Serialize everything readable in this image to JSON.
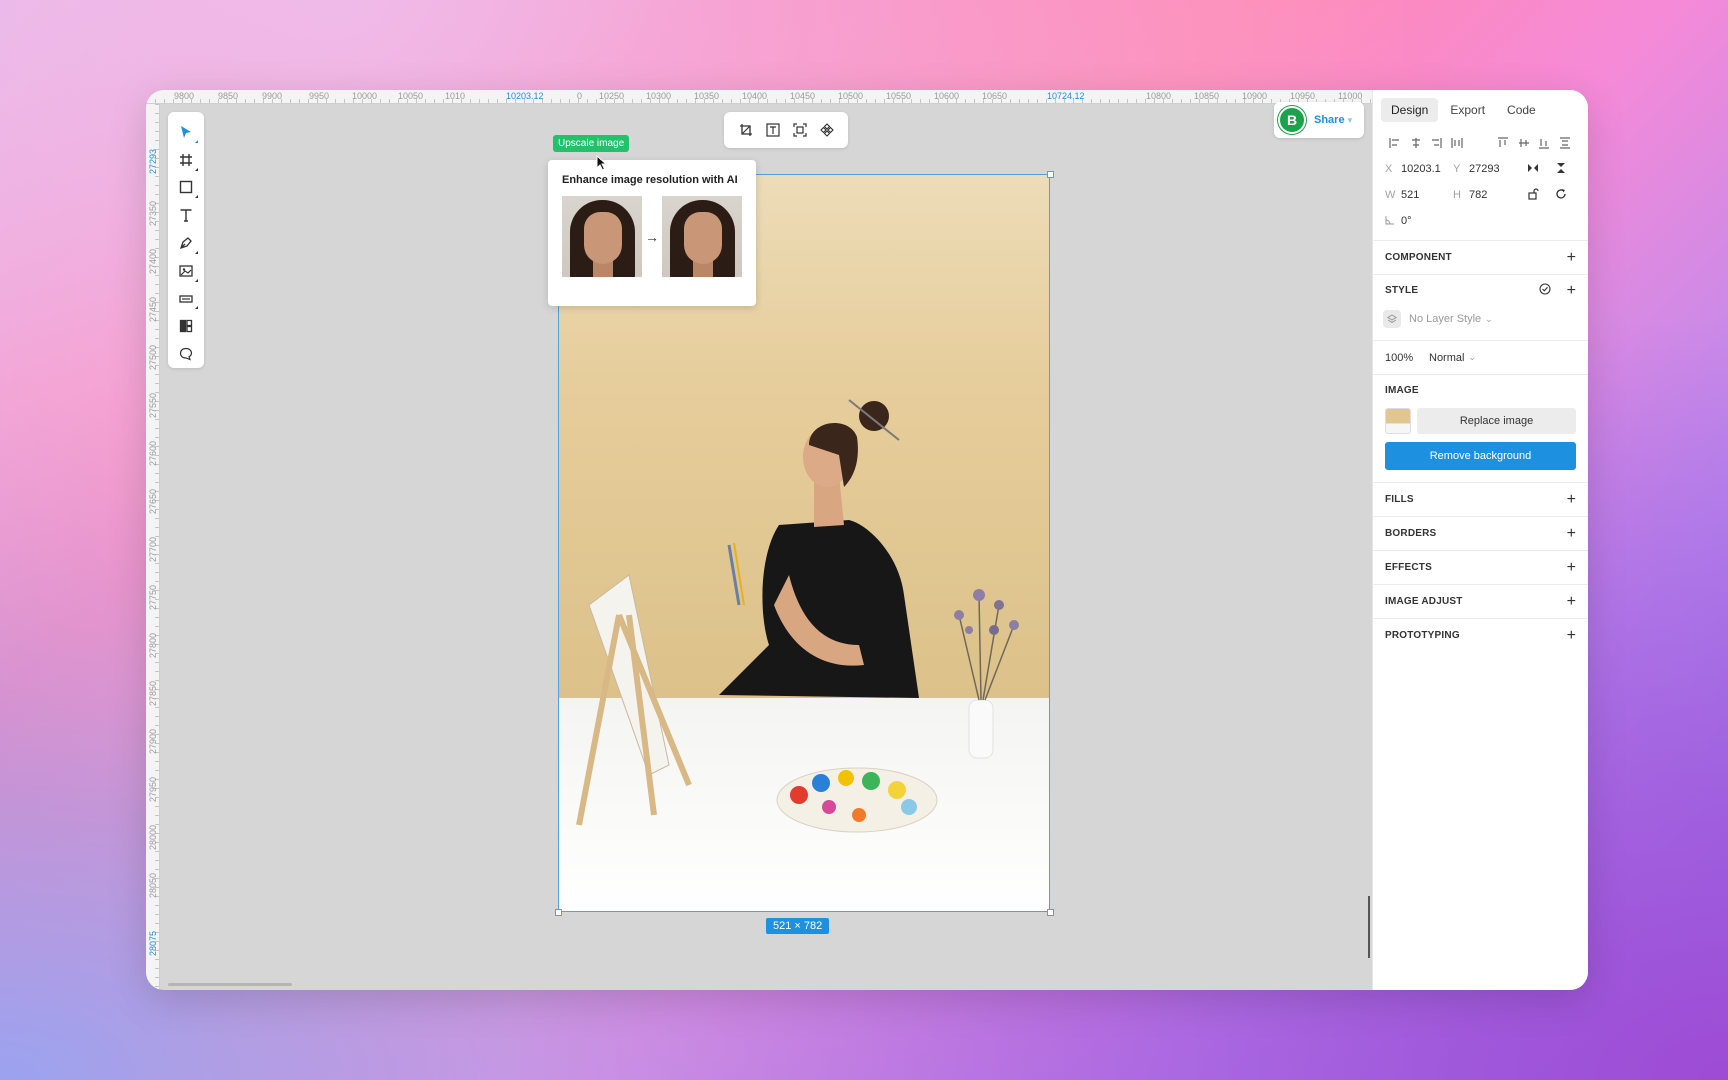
{
  "ruler_top": {
    "labels": [
      "9800",
      "9850",
      "9900",
      "9950",
      "10000",
      "10050",
      "1010",
      "10203.12",
      "0",
      "10250",
      "10300",
      "10350",
      "10400",
      "10450",
      "10500",
      "10550",
      "10600",
      "10650",
      "10724.12",
      "10800",
      "10850",
      "10900",
      "10950",
      "11000",
      "110"
    ],
    "highlighted": [
      "10203.12",
      "10724.12"
    ]
  },
  "ruler_left": {
    "labels": [
      "27293",
      "27350",
      "27400",
      "27450",
      "27500",
      "27550",
      "27600",
      "27650",
      "27700",
      "27750",
      "27800",
      "27850",
      "27900",
      "27950",
      "28000",
      "28050",
      "28075"
    ],
    "highlighted": [
      "27293",
      "28075"
    ]
  },
  "toolbar": {
    "tools": [
      "move-tool",
      "frame-tool",
      "rectangle-tool",
      "text-tool",
      "pen-tool",
      "image-tool",
      "component-tool",
      "layout-tool",
      "comment-tool"
    ]
  },
  "actionbar": {
    "actions": [
      "crop-icon",
      "text-frame-icon",
      "upscale-icon",
      "component-icon"
    ]
  },
  "share": {
    "avatar_letter": "B",
    "label": "Share"
  },
  "canvas": {
    "upscale_tag": "Upscale image",
    "popover_title": "Enhance image resolution with AI",
    "size_badge": "521 × 782"
  },
  "panel": {
    "tabs": [
      "Design",
      "Export",
      "Code"
    ],
    "active_tab": "Design",
    "x_label": "X",
    "x_value": "10203.1",
    "y_label": "Y",
    "y_value": "27293",
    "w_label": "W",
    "w_value": "521",
    "h_label": "H",
    "h_value": "782",
    "rotation": "0°",
    "component_title": "COMPONENT",
    "style_title": "STYLE",
    "style_value": "No Layer Style",
    "opacity": "100%",
    "blend": "Normal",
    "image_title": "IMAGE",
    "replace_label": "Replace image",
    "remove_bg_label": "Remove background",
    "fills_title": "FILLS",
    "borders_title": "BORDERS",
    "effects_title": "EFFECTS",
    "image_adjust_title": "IMAGE ADJUST",
    "prototyping_title": "PROTOTYPING"
  },
  "colors": {
    "accent": "#1e90e0",
    "upscale_green": "#24c16b",
    "canvas_bg": "#d6d6d6"
  }
}
